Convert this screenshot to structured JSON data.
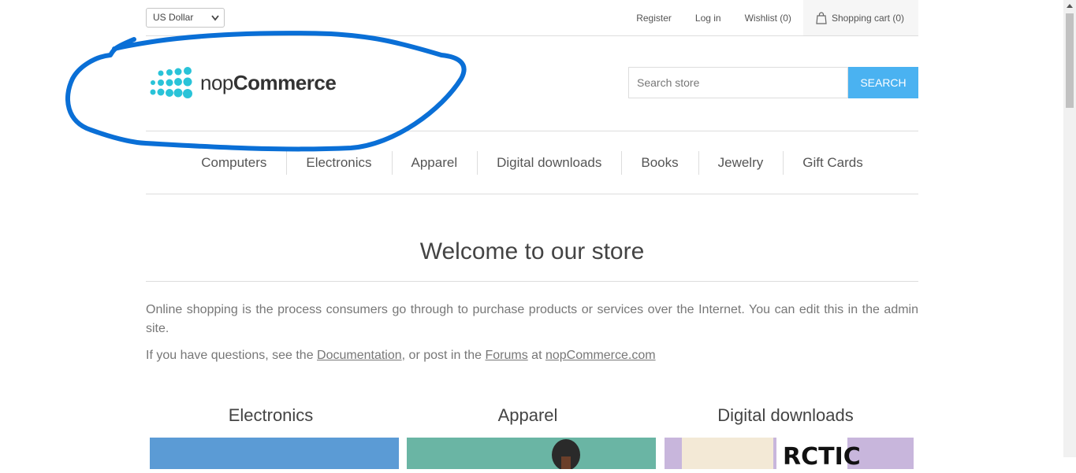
{
  "header": {
    "currency_selected": "US Dollar",
    "links": {
      "register": "Register",
      "login": "Log in",
      "wishlist": "Wishlist (0)",
      "cart": "Shopping cart (0)"
    }
  },
  "logo": {
    "text_light": "nop",
    "text_bold": "Commerce"
  },
  "search": {
    "placeholder": "Search store",
    "button": "SEARCH"
  },
  "menu": [
    "Computers",
    "Electronics",
    "Apparel",
    "Digital downloads",
    "Books",
    "Jewelry",
    "Gift Cards"
  ],
  "content": {
    "title": "Welcome to our store",
    "paragraph1": "Online shopping is the process consumers go through to purchase products or services over the Internet. You can edit this in the admin site.",
    "p2_before": "If you have questions, see the ",
    "p2_link1": "Documentation",
    "p2_mid1": ", or post in the ",
    "p2_link2": "Forums",
    "p2_mid2": " at ",
    "p2_link3": "nopCommerce.com"
  },
  "categories": [
    {
      "title": "Electronics",
      "color": "#5b9bd5"
    },
    {
      "title": "Apparel",
      "color": "#6ab5a4"
    },
    {
      "title": "Digital downloads",
      "color": "#c8b6dc"
    }
  ],
  "colors": {
    "accent": "#4ab2f1",
    "logo": "#29c3d8",
    "annotation": "#0a6fd6"
  }
}
